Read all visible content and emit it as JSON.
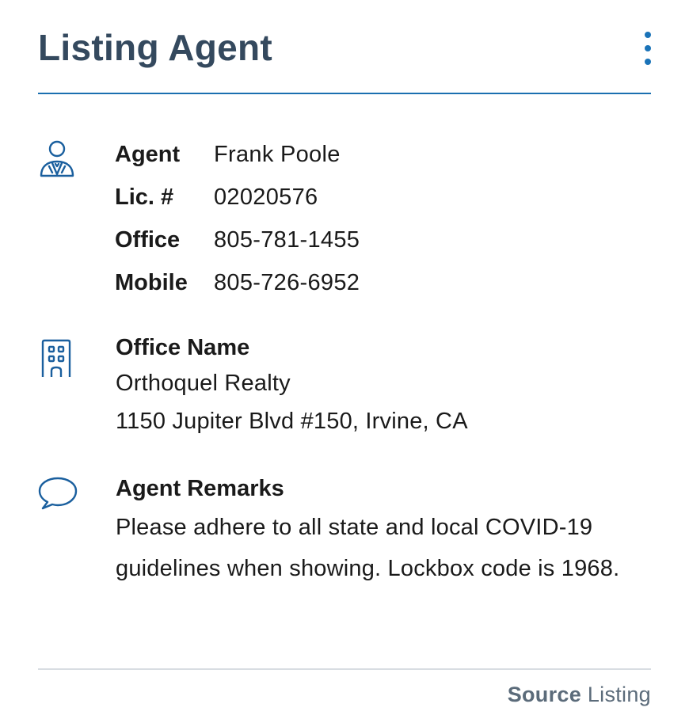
{
  "header": {
    "title": "Listing Agent",
    "menu_icon": "more-vertical-icon",
    "accent_color": "#1a73b8",
    "title_color": "#34495e"
  },
  "agent": {
    "icon": "agent-person-icon",
    "rows": [
      {
        "label": "Agent",
        "value": "Frank Poole"
      },
      {
        "label": "Lic. #",
        "value": "02020576"
      },
      {
        "label": "Office",
        "value": "805-781-1455"
      },
      {
        "label": "Mobile",
        "value": "805-726-6952"
      }
    ]
  },
  "office": {
    "icon": "office-building-icon",
    "title": "Office Name",
    "name": "Orthoquel Realty",
    "address": "1150 Jupiter Blvd #150, Irvine, CA"
  },
  "remarks": {
    "icon": "speech-bubble-icon",
    "title": "Agent Remarks",
    "text": "Please adhere to all state and local COVID-19 guidelines when showing. Lockbox code is 1968."
  },
  "footer": {
    "source_label": "Source",
    "source_value": "Listing"
  }
}
